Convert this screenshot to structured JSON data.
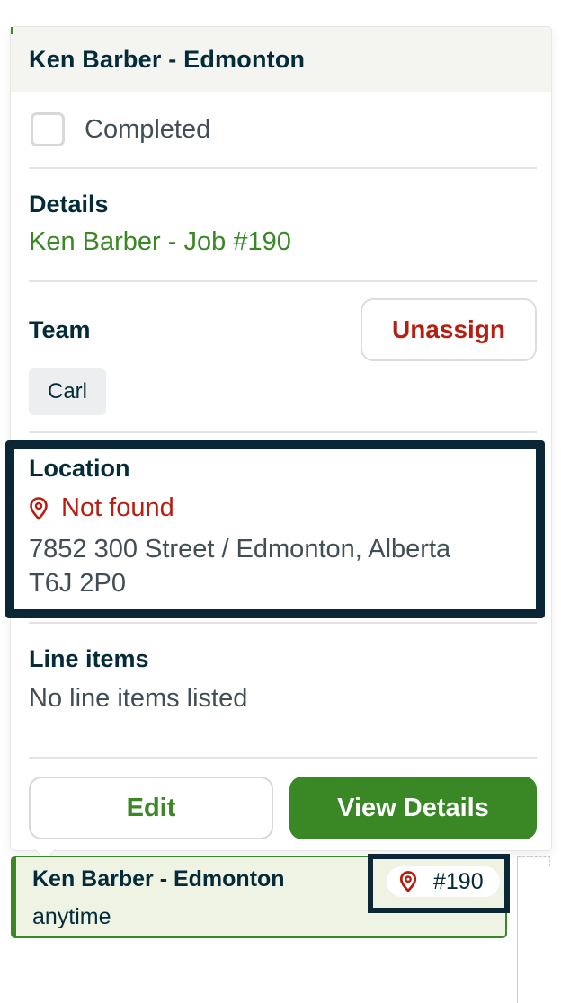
{
  "popover": {
    "title": "Ken Barber - Edmonton",
    "completed_label": "Completed",
    "details": {
      "heading": "Details",
      "client": "Ken Barber",
      "separator": "-",
      "job": "Job #190"
    },
    "team": {
      "heading": "Team",
      "unassign_label": "Unassign",
      "members": [
        "Carl"
      ]
    },
    "location": {
      "heading": "Location",
      "status": "Not found",
      "address_line1": "7852 300 Street / Edmonton, Alberta",
      "address_line2": "T6J 2P0"
    },
    "line_items": {
      "heading": "Line items",
      "empty_text": "No line items listed"
    },
    "actions": {
      "edit_label": "Edit",
      "view_details_label": "View Details"
    }
  },
  "event": {
    "title": "Ken Barber - Edmonton",
    "time": "anytime",
    "badge_number": "#190"
  },
  "colors": {
    "brand_green": "#3a8725",
    "error_red": "#b71e11",
    "navy_text": "#032b3a",
    "highlight_border": "#0b2634"
  },
  "icons": {
    "location_status": "map-pin-icon",
    "event_badge": "map-pin-icon"
  }
}
